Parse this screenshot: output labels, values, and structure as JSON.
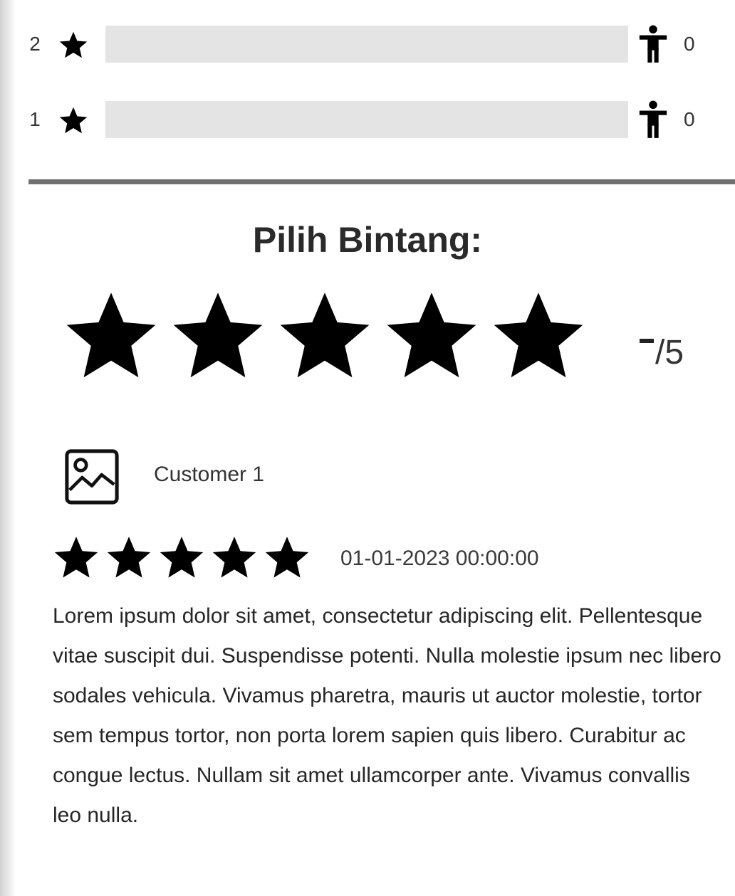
{
  "distribution": [
    {
      "stars": "2",
      "count": "0",
      "fraction": 0
    },
    {
      "stars": "1",
      "count": "0",
      "fraction": 0
    }
  ],
  "picker": {
    "title": "Pilih Bintang:",
    "star_count": 5,
    "selected_value": "",
    "out_of": "/5"
  },
  "review": {
    "customer_name": "Customer 1",
    "rating": 5,
    "timestamp": "01-01-2023 00:00:00",
    "text": "Lorem ipsum dolor sit amet, consectetur adipiscing elit. Pellentesque vitae suscipit dui. Suspendisse potenti. Nulla molestie ipsum nec libero sodales vehicula. Vivamus pharetra, mauris ut auctor molestie, tortor sem tempus tortor, non porta lorem sapien quis libero. Curabitur ac congue lectus. Nullam sit amet ullamcorper ante. Vivamus convallis leo nulla."
  },
  "icons": {
    "row_star": "star-icon",
    "row_person": "person-icon",
    "avatar": "image-placeholder-icon"
  },
  "colors": {
    "bar_track": "#e4e4e4",
    "star": "#000000",
    "divider": "#707070"
  }
}
